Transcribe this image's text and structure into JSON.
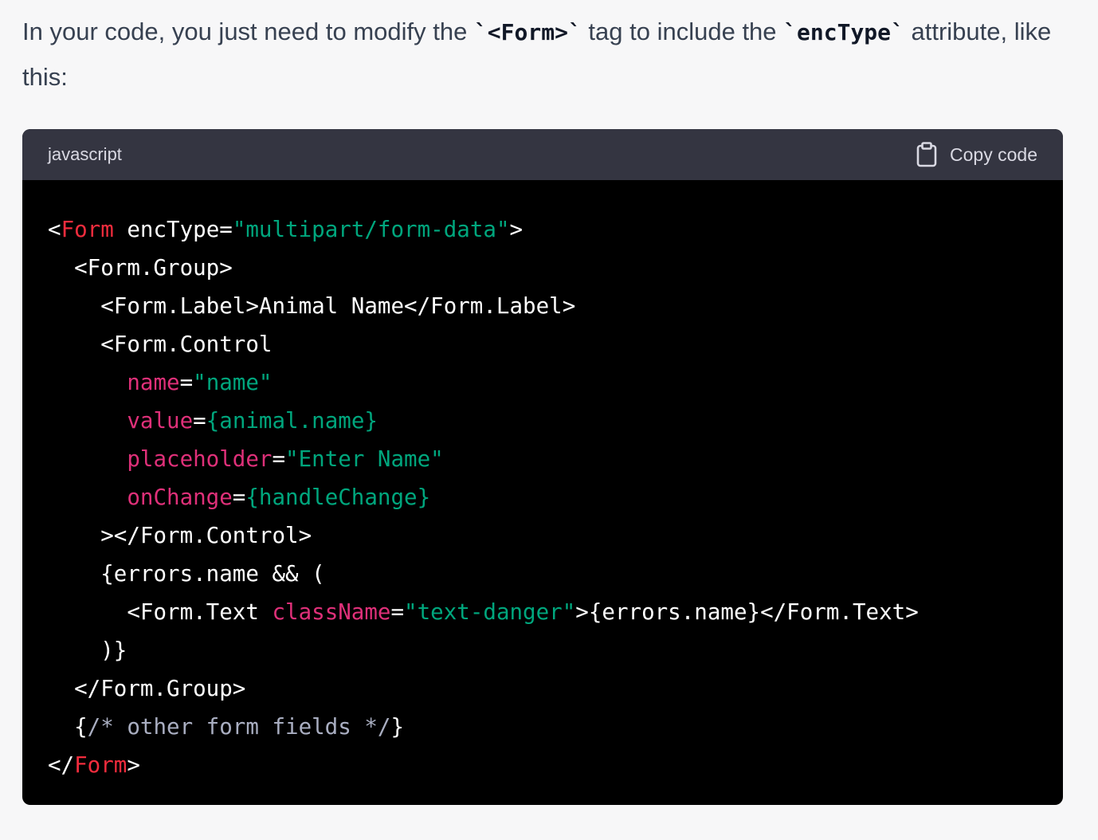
{
  "message": {
    "text_1": "In your code, you just need to modify the ",
    "code_1": "`<Form>`",
    "text_2": " tag to include the ",
    "code_2": "`encType`",
    "text_3": " attribute, like this:"
  },
  "code_block": {
    "language": "javascript",
    "copy_label": "Copy code",
    "lines": [
      [
        {
          "t": "<",
          "c": "plain"
        },
        {
          "t": "Form",
          "c": "kw"
        },
        {
          "t": " encType=",
          "c": "plain"
        },
        {
          "t": "\"multipart/form-data\"",
          "c": "str"
        },
        {
          "t": ">",
          "c": "plain"
        }
      ],
      [
        {
          "t": "  <Form.Group>",
          "c": "plain"
        }
      ],
      [
        {
          "t": "    <Form.Label>Animal Name</Form.Label>",
          "c": "plain"
        }
      ],
      [
        {
          "t": "    <Form.Control",
          "c": "plain"
        }
      ],
      [
        {
          "t": "      ",
          "c": "plain"
        },
        {
          "t": "name",
          "c": "attr"
        },
        {
          "t": "=",
          "c": "plain"
        },
        {
          "t": "\"name\"",
          "c": "str"
        }
      ],
      [
        {
          "t": "      ",
          "c": "plain"
        },
        {
          "t": "value",
          "c": "attr"
        },
        {
          "t": "=",
          "c": "plain"
        },
        {
          "t": "{animal.name}",
          "c": "str"
        }
      ],
      [
        {
          "t": "      ",
          "c": "plain"
        },
        {
          "t": "placeholder",
          "c": "attr"
        },
        {
          "t": "=",
          "c": "plain"
        },
        {
          "t": "\"Enter Name\"",
          "c": "str"
        }
      ],
      [
        {
          "t": "      ",
          "c": "plain"
        },
        {
          "t": "onChange",
          "c": "attr"
        },
        {
          "t": "=",
          "c": "plain"
        },
        {
          "t": "{handleChange}",
          "c": "str"
        }
      ],
      [
        {
          "t": "    ></Form.Control>",
          "c": "plain"
        }
      ],
      [
        {
          "t": "    {errors.name && (",
          "c": "plain"
        }
      ],
      [
        {
          "t": "      <Form.Text ",
          "c": "plain"
        },
        {
          "t": "className",
          "c": "attr"
        },
        {
          "t": "=",
          "c": "plain"
        },
        {
          "t": "\"text-danger\"",
          "c": "str"
        },
        {
          "t": ">{errors.name}</Form.Text>",
          "c": "plain"
        }
      ],
      [
        {
          "t": "    )}",
          "c": "plain"
        }
      ],
      [
        {
          "t": "  </Form.Group>",
          "c": "plain"
        }
      ],
      [
        {
          "t": "  {",
          "c": "plain"
        },
        {
          "t": "/* other form fields */",
          "c": "cmt"
        },
        {
          "t": "}",
          "c": "plain"
        }
      ],
      [
        {
          "t": "</",
          "c": "plain"
        },
        {
          "t": "Form",
          "c": "kw"
        },
        {
          "t": ">",
          "c": "plain"
        }
      ]
    ]
  },
  "colors": {
    "page_bg": "#f7f7f8",
    "header_bg": "#343541",
    "code_bg": "#000000",
    "keyword": "#f22c3d",
    "attribute": "#df3079",
    "string": "#00a67d",
    "comment": "#a9aec1"
  },
  "icons": {
    "copy": "clipboard-icon"
  }
}
